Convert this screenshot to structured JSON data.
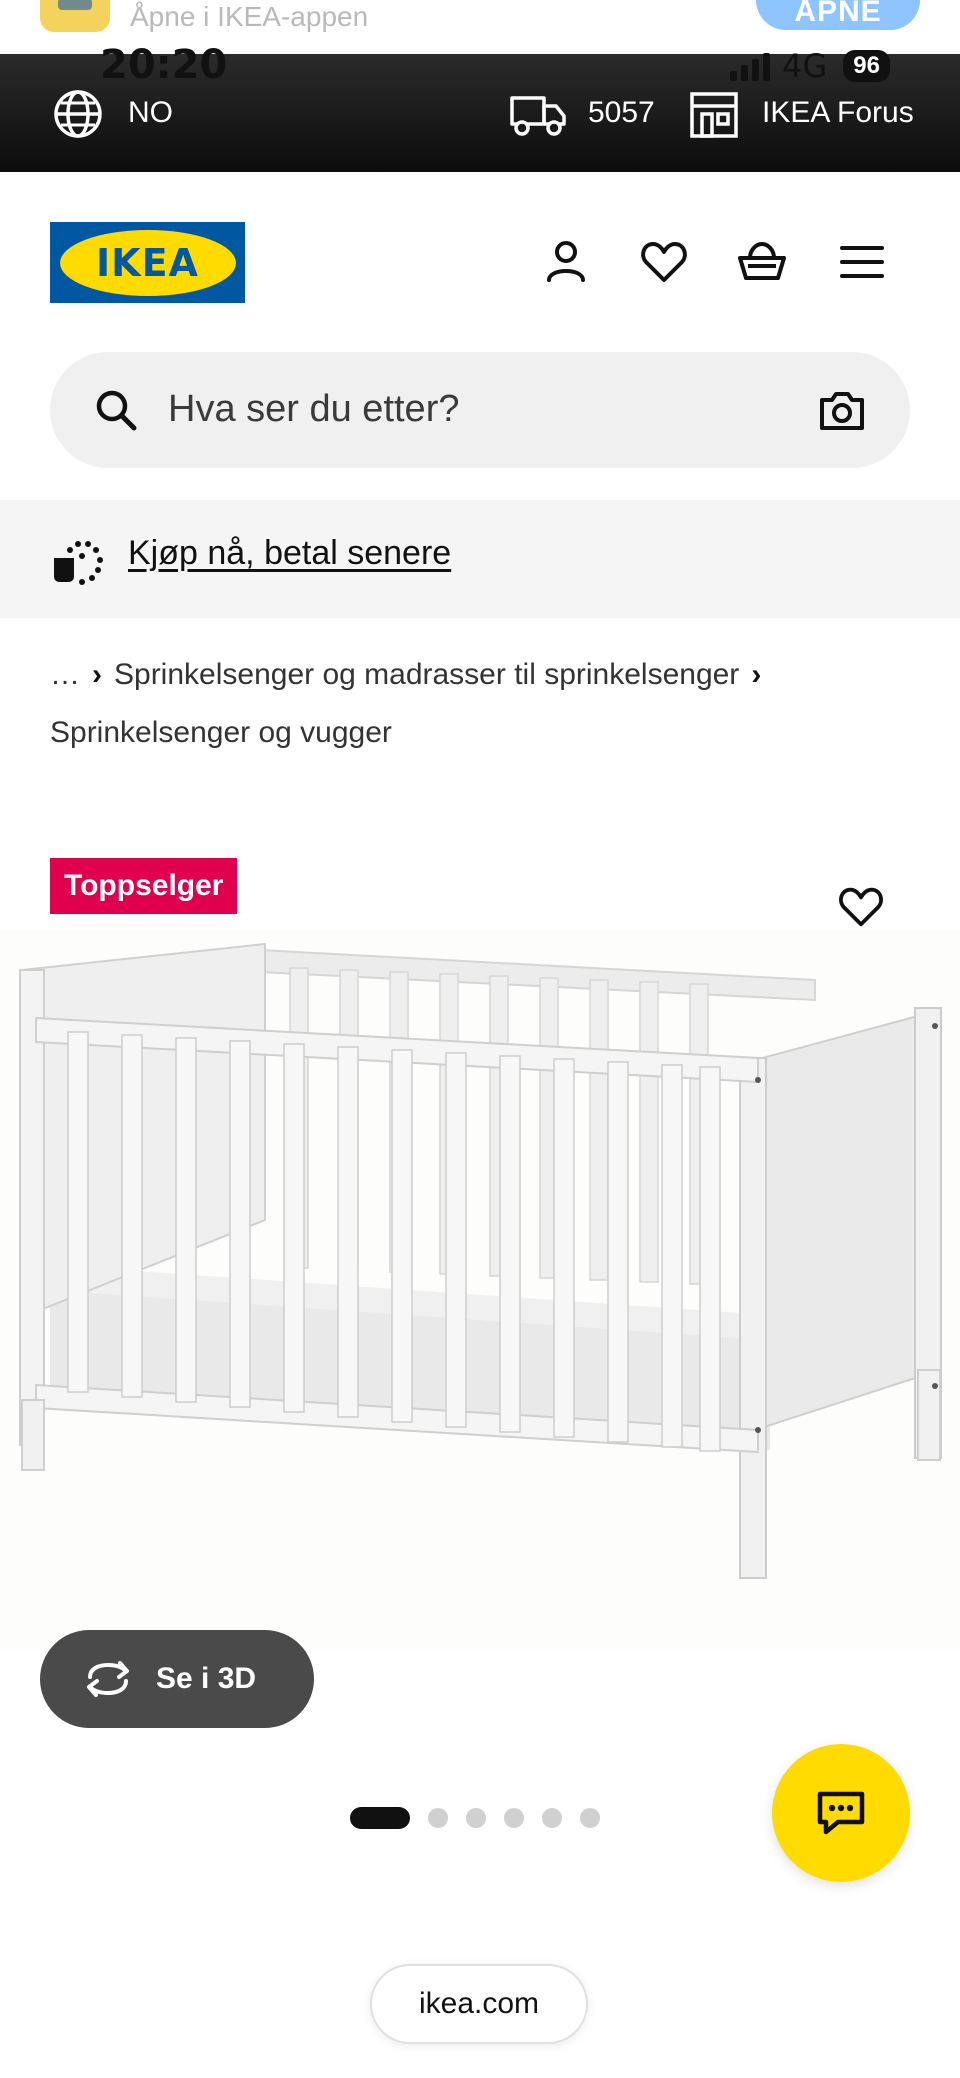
{
  "app_banner": {
    "text": "Åpne i IKEA-appen",
    "open_label": "ÅPNE"
  },
  "status_bar": {
    "time": "20:20",
    "network": "4G",
    "battery": "96"
  },
  "location_bar": {
    "country": "NO",
    "postcode": "5057",
    "store": "IKEA Forus"
  },
  "header": {
    "logo_text": "IKEA",
    "icons": [
      "profile-icon",
      "heart-icon",
      "basket-icon",
      "menu-icon"
    ]
  },
  "search": {
    "placeholder": "Hva ser du etter?"
  },
  "promo": {
    "link_text": "Kjøp nå, betal senere"
  },
  "breadcrumb": {
    "items": [
      "…",
      "Sprinkelsenger og madrasser til sprinkelsenger",
      "Sprinkelsenger og vugger"
    ]
  },
  "product": {
    "badge": "Toppselger",
    "see_3d_label": "Se i 3D"
  },
  "carousel": {
    "total": 6,
    "active_index": 0
  },
  "browser": {
    "url": "ikea.com"
  },
  "colors": {
    "brand_blue": "#0058a3",
    "brand_yellow": "#ffdb00",
    "badge_red": "#e0004d"
  }
}
